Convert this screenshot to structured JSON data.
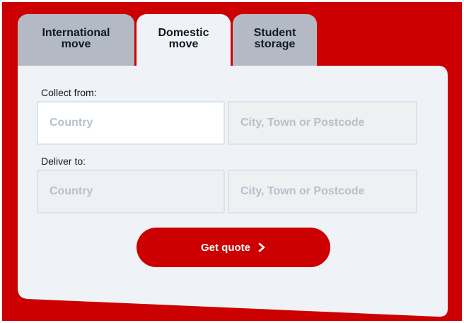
{
  "tabs": [
    {
      "label_line1": "International",
      "label_line2": "move",
      "active": false
    },
    {
      "label_line1": "Domestic",
      "label_line2": "move",
      "active": true
    },
    {
      "label_line1": "Student",
      "label_line2": "storage",
      "active": false
    }
  ],
  "collect": {
    "label": "Collect from:",
    "country_placeholder": "Country",
    "city_placeholder": "City, Town or Postcode"
  },
  "deliver": {
    "label": "Deliver to:",
    "country_placeholder": "Country",
    "city_placeholder": "City, Town or Postcode"
  },
  "quote_button": {
    "label": "Get quote",
    "icon": "chevron-right-icon"
  },
  "colors": {
    "brand_red": "#cc0000",
    "panel": "#eff2f6",
    "inactive_tab": "#b3bac3"
  }
}
